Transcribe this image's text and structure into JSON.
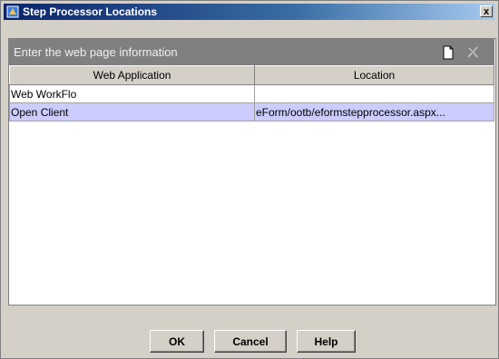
{
  "window": {
    "title": "Step Processor Locations",
    "close_label": "x"
  },
  "panel": {
    "prompt": "Enter the web page information"
  },
  "table": {
    "columns": [
      "Web Application",
      "Location"
    ],
    "rows": [
      {
        "app": "Web WorkFlo",
        "location": "",
        "selected": false
      },
      {
        "app": "Open Client",
        "location": "eForm/ootb/eformstepprocessor.aspx...",
        "selected": true
      }
    ]
  },
  "buttons": {
    "ok": "OK",
    "cancel": "Cancel",
    "help": "Help"
  },
  "colors": {
    "title_bar": "#0a246a",
    "selected_row": "#ccccff",
    "panel_header": "#808080",
    "dialog_bg": "#d4d0c8"
  }
}
